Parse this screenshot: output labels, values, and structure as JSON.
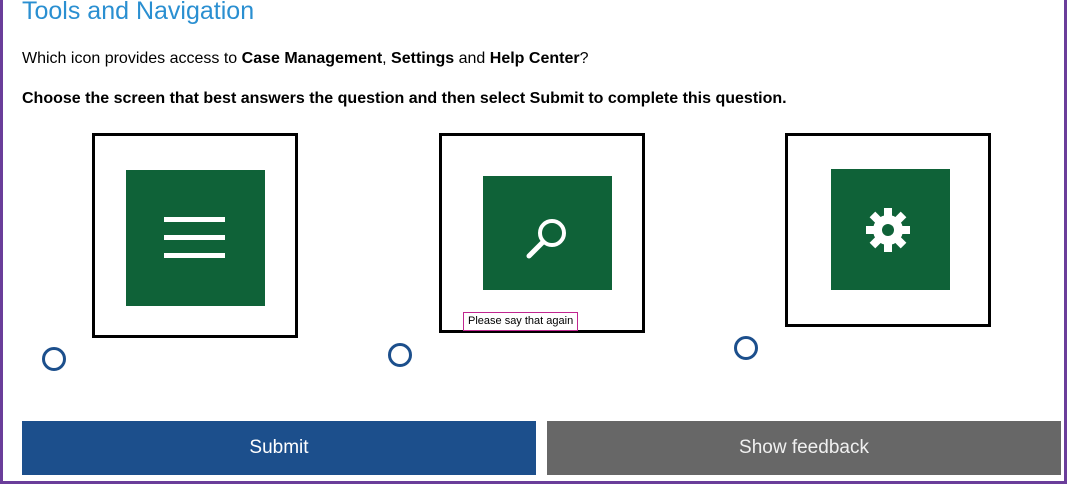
{
  "header": {
    "title": "Tools and Navigation"
  },
  "question": {
    "prefix": "Which icon provides access to ",
    "term1": "Case Management",
    "sep1": ", ",
    "term2": "Settings",
    "sep2": " and ",
    "term3": "Help Center",
    "suffix": "?"
  },
  "instruction": "Choose the screen that best answers the question and then select Submit to complete this question.",
  "options": [
    {
      "icon": "menu-icon",
      "selected": false
    },
    {
      "icon": "search-icon",
      "selected": false
    },
    {
      "icon": "gear-icon",
      "selected": false
    }
  ],
  "tooltip": "Please say that again",
  "buttons": {
    "submit_label": "Submit",
    "feedback_label": "Show feedback"
  },
  "colors": {
    "title": "#2a8fd1",
    "tile": "#0f6238",
    "radio": "#1c4f8c",
    "submit_bg": "#1c4f8c",
    "feedback_bg": "#676767",
    "frame": "#6a3d9a",
    "tooltip_border": "#c0268f"
  }
}
